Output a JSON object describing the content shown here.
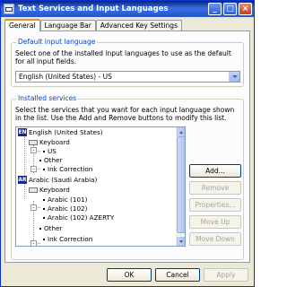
{
  "window": {
    "title": "Text Services and Input Languages",
    "controls": [
      "_",
      "□",
      "×"
    ]
  },
  "tabs": [
    {
      "label": "General",
      "active": true
    },
    {
      "label": "Language Bar",
      "active": false
    },
    {
      "label": "Advanced Key Settings",
      "active": false
    }
  ],
  "default_language": {
    "group_label": "Default input language",
    "description": "Select one of the installed input languages to use as the default for all input fields.",
    "selected": "English (United States) - US"
  },
  "installed_services": {
    "group_label": "Installed services",
    "description": "Select the services that you want for each input language shown in the list. Use the Add and Remove buttons to modify this list.",
    "tree": [
      {
        "text": "English (United States)",
        "kind": "language",
        "badge": "EN"
      },
      {
        "text": "Keyboard",
        "kind": "category"
      },
      {
        "text": "US",
        "kind": "item"
      },
      {
        "text": "Other",
        "kind": "category"
      },
      {
        "text": "Ink Correction",
        "kind": "item"
      },
      {
        "text": "Arabic (Saudi Arabia)",
        "kind": "language",
        "badge": "AR"
      },
      {
        "text": "Keyboard",
        "kind": "category"
      },
      {
        "text": "Arabic (101)",
        "kind": "item"
      },
      {
        "text": "Arabic (102)",
        "kind": "item"
      },
      {
        "text": "Arabic (102) AZERTY",
        "kind": "item"
      },
      {
        "text": "Other",
        "kind": "category"
      },
      {
        "text": "Ink Correction",
        "kind": "item"
      }
    ],
    "buttons": {
      "add": "Add...",
      "remove": "Remove",
      "properties": "Properties...",
      "move_up": "Move Up",
      "move_down": "Move Down"
    }
  },
  "footer": {
    "ok": "OK",
    "cancel": "Cancel",
    "apply": "Apply"
  }
}
